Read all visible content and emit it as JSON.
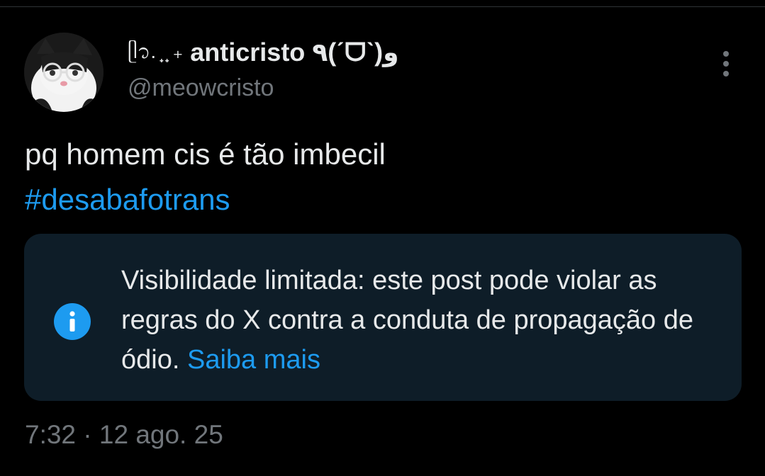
{
  "author": {
    "display_name_prefix": "ᥫ᭡. ̟ ̟ ₊",
    "display_name": "anticristo ٩(ˊᗜˋ)و",
    "handle": "@meowcristo",
    "avatar_icon": "cat-with-glasses-avatar"
  },
  "tweet": {
    "text": "pq homem cis é tão imbecil",
    "hashtag": "#desabafotrans"
  },
  "notice": {
    "icon": "info-icon",
    "text": "Visibilidade limitada: este post pode violar as regras do X contra a conduta de propagação de ódio. ",
    "link": "Saiba mais"
  },
  "meta": {
    "timestamp": "7:32 · 12 ago. 25"
  },
  "colors": {
    "background": "#000000",
    "text": "#e7e9ea",
    "secondary": "#71767b",
    "accent": "#1d9bf0",
    "notice_bg": "#0e1d28"
  }
}
